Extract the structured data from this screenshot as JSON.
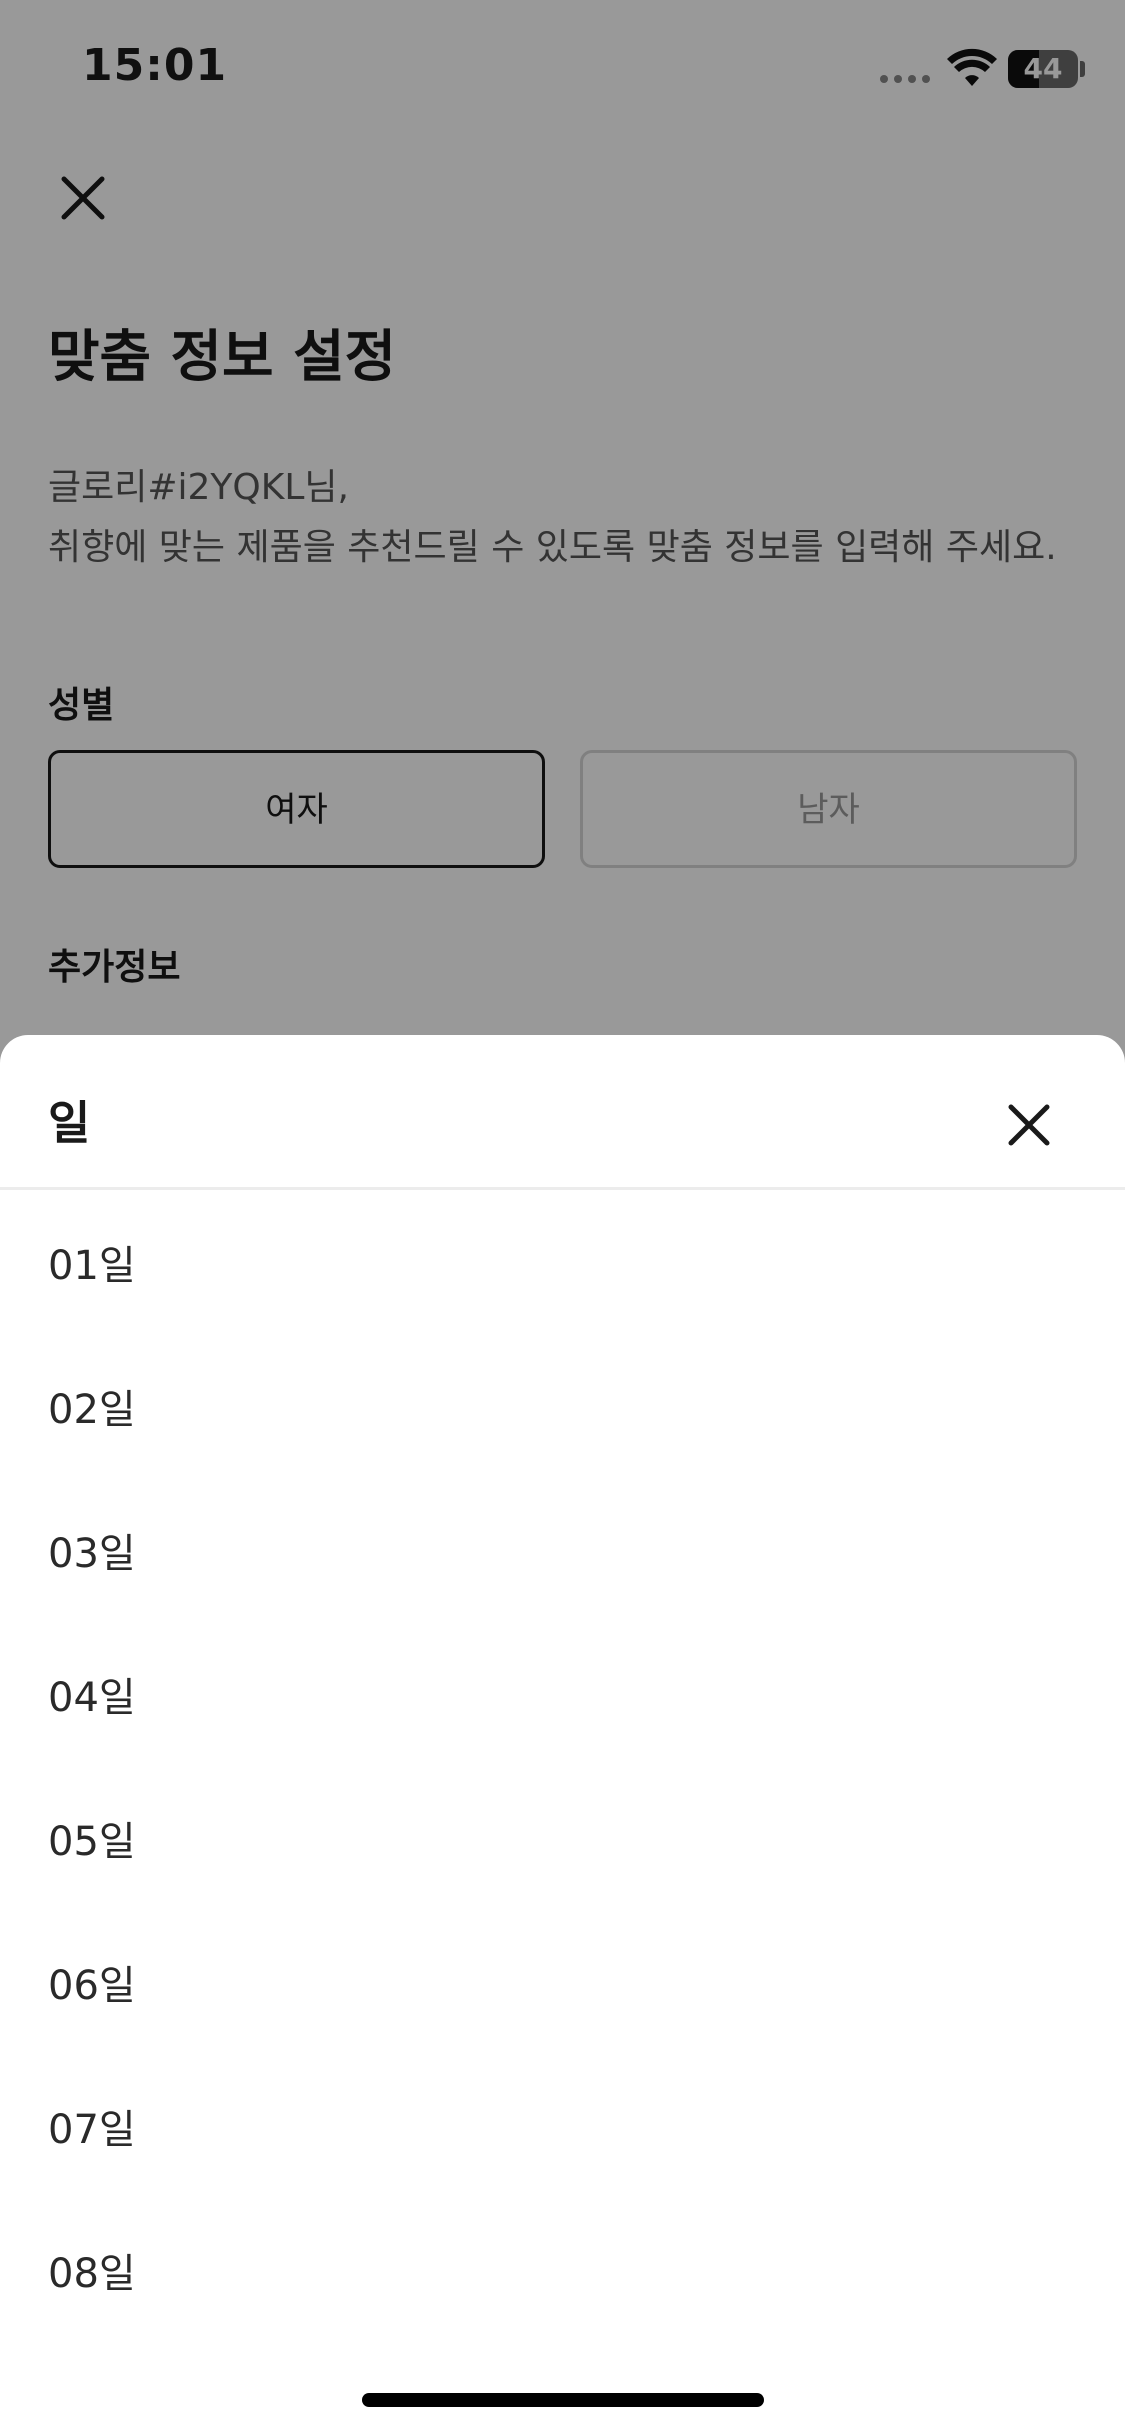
{
  "status_bar": {
    "time": "15:01",
    "battery_level": "44",
    "battery_percent": 44
  },
  "page": {
    "title": "맞춤 정보 설정",
    "greeting_line1": "글로리#i2YQKL님,",
    "greeting_line2": "취향에 맞는 제품을 추천드릴 수 있도록 맞춤 정보를 입력해 주세요.",
    "gender_label": "성별",
    "gender_options": [
      "여자",
      "남자"
    ],
    "gender_selected": "여자",
    "additional_info_label": "추가정보",
    "close_icon": "close-icon"
  },
  "sheet": {
    "title": "일",
    "close_icon": "close-icon",
    "days": [
      "01일",
      "02일",
      "03일",
      "04일",
      "05일",
      "06일",
      "07일",
      "08일"
    ]
  },
  "colors": {
    "overlay": "#000000",
    "text_primary": "#1a1a1a",
    "text_secondary": "#555555",
    "selected_border": "#1a1a1a",
    "unselected_border": "#d6d6d6"
  }
}
